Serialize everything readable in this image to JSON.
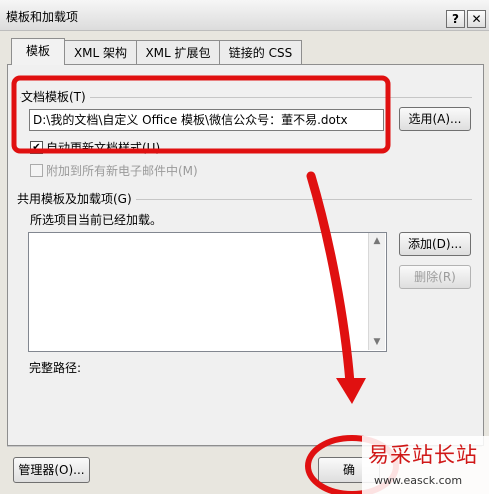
{
  "window": {
    "title": "模板和加载项",
    "help_label": "?",
    "close_label": "✕"
  },
  "tabs": [
    {
      "label": "模板"
    },
    {
      "label": "XML 架构"
    },
    {
      "label": "XML 扩展包"
    },
    {
      "label": "链接的 CSS"
    }
  ],
  "document_template": {
    "group_label": "文档模板(T)",
    "path_value": "D:\\我的文档\\自定义 Office 模板\\微信公众号：董不易.dotx",
    "select_button": "选用(A)..."
  },
  "auto_update": {
    "label": "自动更新文档样式(U)",
    "checked": true
  },
  "attach_email": {
    "label": "附加到所有新电子邮件中(M)",
    "checked": false
  },
  "global_templates": {
    "group_label": "共用模板及加载项(G)",
    "info_text": "所选项目当前已经加载。",
    "add_button": "添加(D)...",
    "remove_button": "删除(R)",
    "full_path_label": "完整路径:"
  },
  "footer": {
    "organizer_button": "管理器(O)...",
    "ok_partial_label": "确"
  },
  "watermark": {
    "text": "易采站长站",
    "url": "www.easck.com"
  },
  "colors": {
    "annotation_red": "#e01010",
    "window_bg": "#f0f0f0"
  }
}
